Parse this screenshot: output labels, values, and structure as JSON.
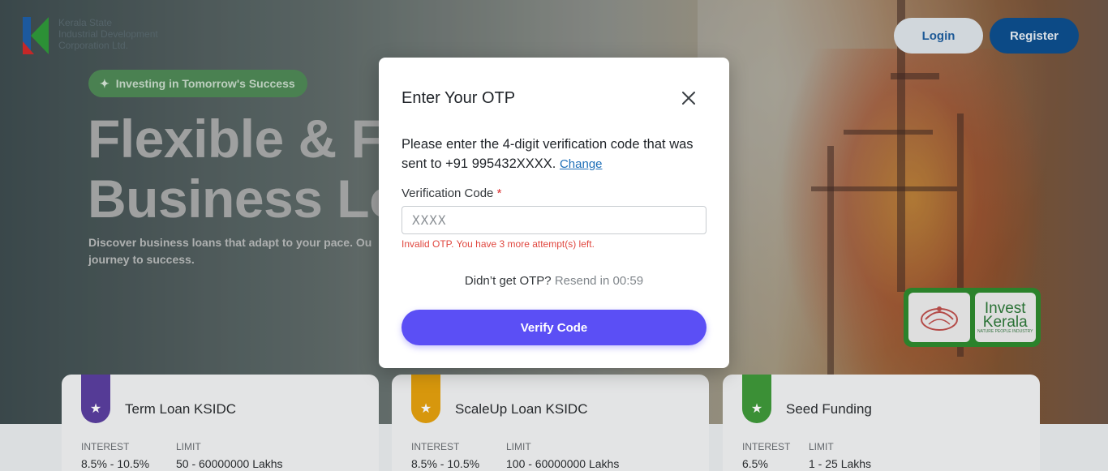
{
  "brand": {
    "name_lines": [
      "Kerala State",
      "Industrial Development",
      "Corporation Ltd."
    ]
  },
  "header": {
    "login_label": "Login",
    "register_label": "Register"
  },
  "hero": {
    "pill_label": "Investing in Tomorrow's Success",
    "headline_line1": "Flexible & Fo",
    "headline_line2": "Business Lo",
    "subtext_line1": "Discover business loans that adapt to your pace. Ou",
    "subtext_line2": "journey to success."
  },
  "badges": {
    "invest_kerala_line1": "Invest",
    "invest_kerala_line2": "Kerala",
    "invest_kerala_tagline": "NATURE PEOPLE INDUSTRY"
  },
  "cards": [
    {
      "title": "Term Loan KSIDC",
      "interest_label": "INTEREST",
      "interest_value": "8.5% - 10.5%",
      "limit_label": "LIMIT",
      "limit_value": "50 - 60000000 Lakhs",
      "accent": "#5b3fa0"
    },
    {
      "title": "ScaleUp Loan KSIDC",
      "interest_label": "INTEREST",
      "interest_value": "8.5% - 10.5%",
      "limit_label": "LIMIT",
      "limit_value": "100 - 60000000 Lakhs",
      "accent": "#e5a10e"
    },
    {
      "title": "Seed Funding",
      "interest_label": "INTEREST",
      "interest_value": "6.5%",
      "limit_label": "LIMIT",
      "limit_value": "1 - 25 Lakhs",
      "accent": "#3f9a3a"
    }
  ],
  "modal": {
    "title": "Enter Your OTP",
    "description": "Please enter the 4-digit verification code that was sent to +91 995432XXXX.",
    "change_link": "Change",
    "field_label": "Verification Code",
    "required_mark": "*",
    "input_placeholder": "XXXX",
    "input_value": "",
    "error_text": "Invalid OTP. You have 3 more attempt(s) left.",
    "resend_prompt": "Didn’t get OTP?",
    "resend_timer": "Resend in 00:59",
    "verify_label": "Verify Code",
    "accent_color": "#5b4ff5",
    "error_color": "#e0473f"
  },
  "icons": {
    "close": "close-icon",
    "sparkle": "sparkle-icon",
    "star": "star-icon",
    "logo": "ksidc-logo-icon",
    "emblem": "kerala-emblem-icon"
  }
}
